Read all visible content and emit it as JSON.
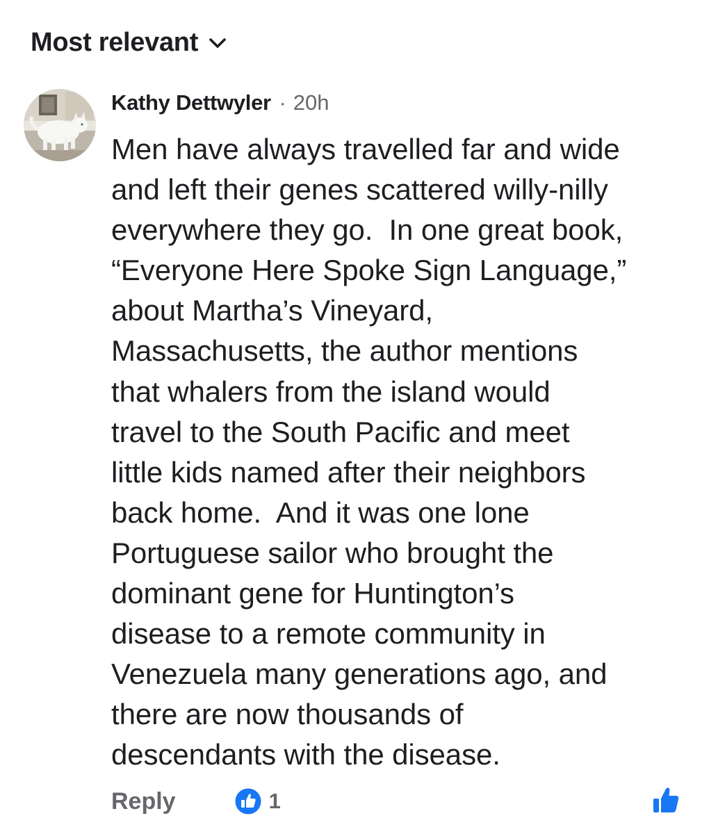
{
  "sort": {
    "label": "Most relevant",
    "icon": "chevron-down-icon"
  },
  "comment": {
    "author": "Kathy Dettwyler",
    "separator": "·",
    "time": "20h",
    "lines": [
      "Men have always travelled far and wide",
      "and left their genes scattered willy-nilly",
      "everywhere they go.  In one great book,",
      "“Everyone Here Spoke Sign Language,”",
      "about Martha’s Vineyard,",
      "Massachusetts, the author mentions",
      "that whalers from the island would",
      "travel to the South Pacific and meet",
      "little kids named after their neighbors",
      "back home.  And it was one lone",
      "Portuguese sailor who brought the",
      "dominant gene for Huntington’s",
      "disease to a remote community in",
      "Venezuela many generations ago, and",
      "there are now thousands of",
      "descendants with the disease."
    ]
  },
  "actions": {
    "reply_label": "Reply",
    "like_count": "1",
    "like_icon": "like-thumbs-up-icon",
    "accent_color": "#1877f2"
  }
}
